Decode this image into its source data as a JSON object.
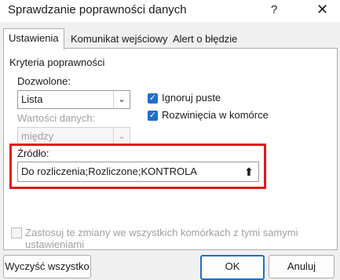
{
  "dialog": {
    "title": "Sprawdzanie poprawności danych",
    "help_glyph": "?",
    "close_glyph": "✕"
  },
  "tabs": [
    {
      "label": "Ustawienia",
      "active": true
    },
    {
      "label": "Komunikat wejściowy",
      "active": false
    },
    {
      "label": "Alert o błędzie",
      "active": false
    }
  ],
  "criteria": {
    "group_label": "Kryteria poprawności",
    "allowed_label": "Dozwolone:",
    "allowed_value": "Lista",
    "data_label": "Wartości danych:",
    "data_value": "między",
    "ignore_blank_label": "Ignoruj puste",
    "ignore_blank_checked": true,
    "dropdown_label": "Rozwinięcia w komórce",
    "dropdown_checked": true,
    "source_label": "Źródło:",
    "source_value": "Do rozliczenia;Rozliczone;KONTROLA"
  },
  "apply_all": {
    "label": "Zastosuj te zmiany we wszystkich komórkach z tymi samymi ustawieniami",
    "checked": false
  },
  "buttons": {
    "clear_all": "Wyczyść wszystko",
    "ok": "OK",
    "cancel": "Anuluj"
  },
  "colors": {
    "accent": "#1f6fc7",
    "highlight": "#e01a1a"
  }
}
